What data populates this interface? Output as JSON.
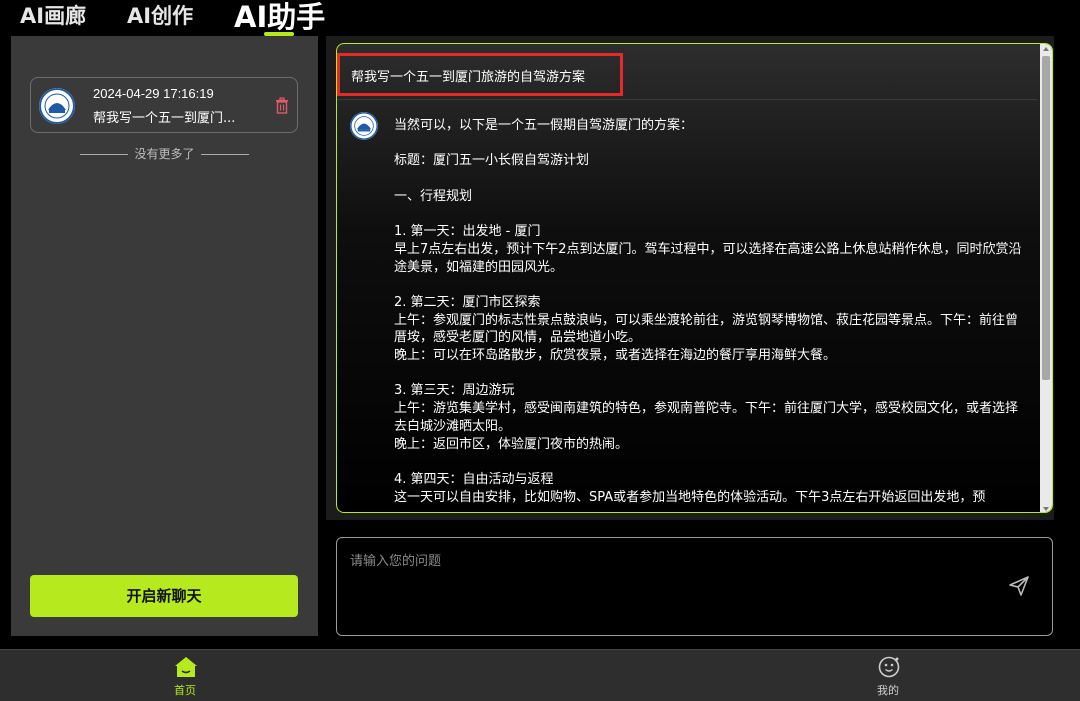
{
  "top_tabs": [
    {
      "label": "AI画廊"
    },
    {
      "label": "AI创作"
    },
    {
      "label": "AI助手"
    }
  ],
  "accent_color": "#b6ea1e",
  "highlight_color": "#e52a2a",
  "sidebar": {
    "history": [
      {
        "date": "2024-04-29 17:16:19",
        "title": "帮我写一个五一到厦门..."
      }
    ],
    "no_more": "没有更多了",
    "new_chat_label": "开启新聊天"
  },
  "chat": {
    "question": "帮我写一个五一到厦门旅游的自驾游方案",
    "answer": [
      "当然可以，以下是一个五一假期自驾游厦门的方案：",
      "",
      "标题：厦门五一小长假自驾游计划",
      "",
      "一、行程规划",
      "",
      "1. 第一天：出发地 - 厦门",
      "早上7点左右出发，预计下午2点到达厦门。驾车过程中，可以选择在高速公路上休息站稍作休息，同时欣赏沿途美景，如福建的田园风光。",
      "",
      "2. 第二天：厦门市区探索",
      "上午：参观厦门的标志性景点鼓浪屿，可以乘坐渡轮前往，游览钢琴博物馆、菽庄花园等景点。下午：前往曾厝垵，感受老厦门的风情，品尝地道小吃。",
      "晚上：可以在环岛路散步，欣赏夜景，或者选择在海边的餐厅享用海鲜大餐。",
      "",
      "3. 第三天：周边游玩",
      "上午：游览集美学村，感受闽南建筑的特色，参观南普陀寺。下午：前往厦门大学，感受校园文化，或者选择去白城沙滩晒太阳。",
      "晚上：返回市区，体验厦门夜市的热闹。",
      "",
      "4. 第四天：自由活动与返程",
      "这一天可以自由安排，比如购物、SPA或者参加当地特色的体验活动。下午3点左右开始返回出发地，预"
    ]
  },
  "input": {
    "placeholder": "请输入您的问题"
  },
  "bottom_nav": {
    "home_label": "首页",
    "me_label": "我的"
  }
}
